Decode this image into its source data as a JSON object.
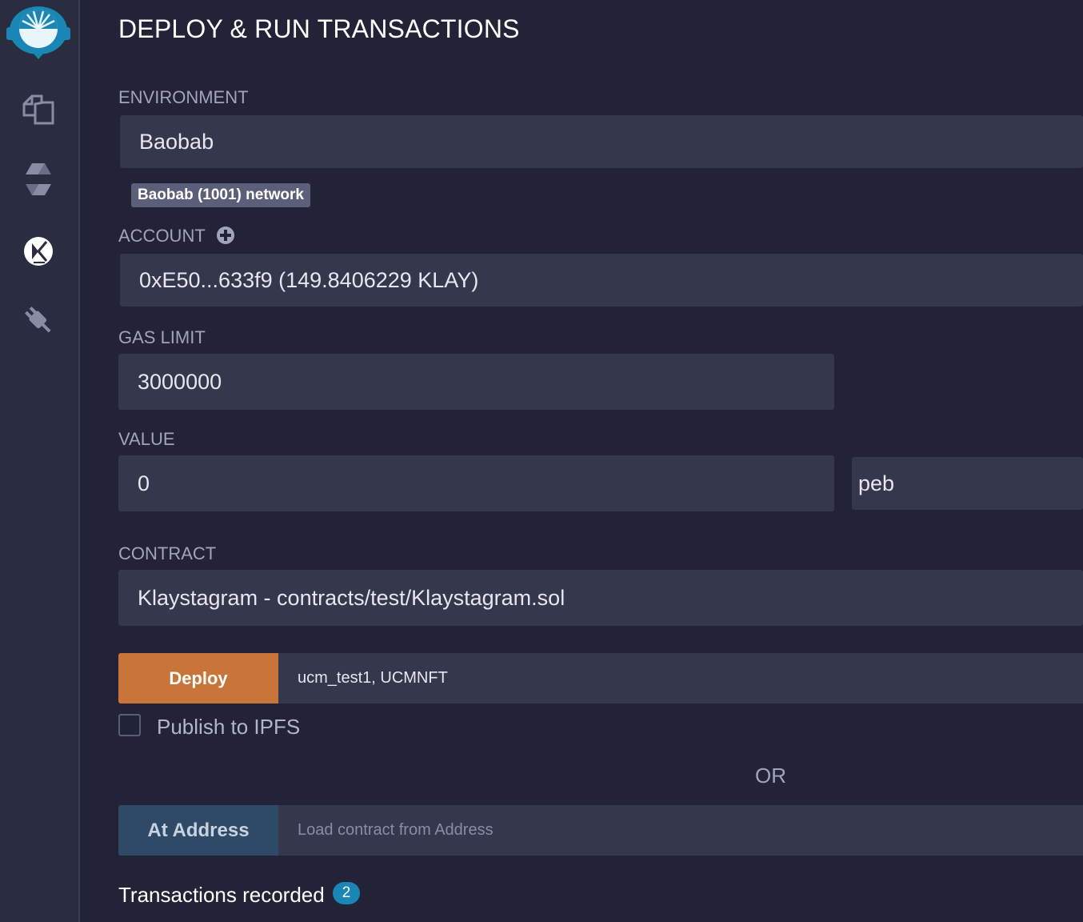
{
  "header": {
    "title": "DEPLOY & RUN TRANSACTIONS"
  },
  "sidebar": {
    "icons": [
      "remix-logo",
      "file-explorer-icon",
      "solidity-compiler-icon",
      "deploy-run-icon",
      "plugin-manager-icon"
    ]
  },
  "environment": {
    "label": "ENVIRONMENT",
    "value": "Baobab",
    "network_badge": "Baobab (1001) network"
  },
  "account": {
    "label": "ACCOUNT",
    "value": "0xE50...633f9 (149.8406229 KLAY)"
  },
  "gas_limit": {
    "label": "GAS LIMIT",
    "value": "3000000"
  },
  "value": {
    "label": "VALUE",
    "amount": "0",
    "unit": "peb"
  },
  "contract": {
    "label": "CONTRACT",
    "value": "Klaystagram - contracts/test/Klaystagram.sol"
  },
  "deploy": {
    "button_label": "Deploy",
    "args": "ucm_test1, UCMNFT"
  },
  "publish": {
    "label": "Publish to IPFS",
    "checked": false
  },
  "or_text": "OR",
  "at_address": {
    "button_label": "At Address",
    "placeholder": "Load contract from Address"
  },
  "transactions": {
    "label": "Transactions recorded",
    "count": "2"
  },
  "colors": {
    "background": "#222336",
    "sidebar": "#2a2c3f",
    "field": "#35374c",
    "deploy_button": "#c97539",
    "at_address_button": "#2e4a66",
    "badge": "#1a86b5"
  }
}
